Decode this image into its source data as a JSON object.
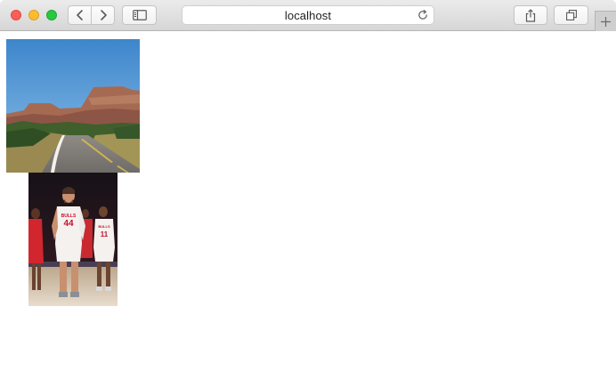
{
  "browser": {
    "address_bar": {
      "url": "localhost"
    },
    "icons": {
      "back": "chevron-left-icon",
      "forward": "chevron-right-icon",
      "sidebar": "sidebar-icon",
      "reload": "reload-icon",
      "share": "share-icon",
      "tabs": "tabs-overview-icon",
      "new_tab": "plus-icon"
    },
    "traffic_lights": {
      "close": "#fc5f57",
      "minimize": "#fdbc2e",
      "maximize": "#28c840"
    }
  },
  "page": {
    "images": [
      {
        "name": "desert-road-photo",
        "subject": "road through desert with mesa"
      },
      {
        "name": "basketball-players-photo",
        "subject": "Bulls players on court",
        "jersey_numbers": [
          "44",
          "11"
        ],
        "jersey_text": "BULLS"
      }
    ]
  }
}
